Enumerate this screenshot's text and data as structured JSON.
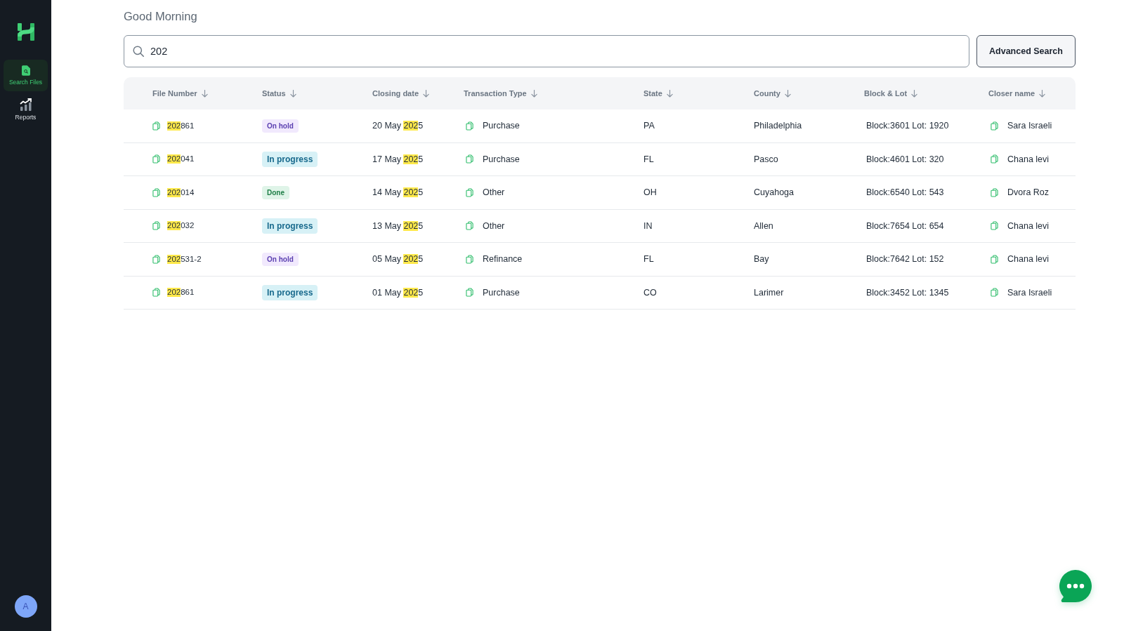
{
  "sidebar": {
    "nav": [
      {
        "label": "Search Files",
        "selected": true
      },
      {
        "label": "Reports",
        "selected": false
      }
    ],
    "avatar": {
      "initial": "A"
    }
  },
  "greeting": "Good Morning",
  "search": {
    "value": "202"
  },
  "advanced_search_button": "Advanced Search",
  "table": {
    "columns": [
      "File Number",
      "Status",
      "Closing date",
      "Transaction Type",
      "State",
      "County",
      "Block & Lot",
      "Closer name"
    ],
    "rows": [
      {
        "file_number": [
          {
            "text": "202",
            "highlighted": true
          },
          {
            "text": "861",
            "highlighted": false
          }
        ],
        "status": {
          "text": "On hold",
          "kind": "hold"
        },
        "closing_date": [
          {
            "text": "20 May ",
            "highlighted": false
          },
          {
            "text": "202",
            "highlighted": true
          },
          {
            "text": "5",
            "highlighted": false
          }
        ],
        "transaction_type": "Purchase",
        "state": "PA",
        "county": "Philadelphia",
        "block_lot": "Block:3601 Lot: 1920",
        "closer_name": "Sara Israeli"
      },
      {
        "file_number": [
          {
            "text": "202",
            "highlighted": true
          },
          {
            "text": "041",
            "highlighted": false
          }
        ],
        "status": {
          "text": "In progress",
          "kind": "progress"
        },
        "closing_date": [
          {
            "text": "17 May ",
            "highlighted": false
          },
          {
            "text": "202",
            "highlighted": true
          },
          {
            "text": "5",
            "highlighted": false
          }
        ],
        "transaction_type": "Purchase",
        "state": "FL",
        "county": "Pasco",
        "block_lot": "Block:4601 Lot: 320",
        "closer_name": "Chana levi"
      },
      {
        "file_number": [
          {
            "text": "202",
            "highlighted": true
          },
          {
            "text": "014",
            "highlighted": false
          }
        ],
        "status": {
          "text": "Done",
          "kind": "done"
        },
        "closing_date": [
          {
            "text": "14 May ",
            "highlighted": false
          },
          {
            "text": "202",
            "highlighted": true
          },
          {
            "text": "5",
            "highlighted": false
          }
        ],
        "transaction_type": "Other",
        "state": "OH",
        "county": "Cuyahoga",
        "block_lot": "Block:6540 Lot: 543",
        "closer_name": "Dvora Roz"
      },
      {
        "file_number": [
          {
            "text": "202",
            "highlighted": true
          },
          {
            "text": "032",
            "highlighted": false
          }
        ],
        "status": {
          "text": "In progress",
          "kind": "progress"
        },
        "closing_date": [
          {
            "text": "13 May ",
            "highlighted": false
          },
          {
            "text": "202",
            "highlighted": true
          },
          {
            "text": "5",
            "highlighted": false
          }
        ],
        "transaction_type": "Other",
        "state": "IN",
        "county": "Allen",
        "block_lot": "Block:7654 Lot: 654",
        "closer_name": "Chana levi"
      },
      {
        "file_number": [
          {
            "text": "202",
            "highlighted": true
          },
          {
            "text": "531-2",
            "highlighted": false
          }
        ],
        "status": {
          "text": "On hold",
          "kind": "hold"
        },
        "closing_date": [
          {
            "text": "05 May ",
            "highlighted": false
          },
          {
            "text": "202",
            "highlighted": true
          },
          {
            "text": "5",
            "highlighted": false
          }
        ],
        "transaction_type": "Refinance",
        "state": "FL",
        "county": "Bay",
        "block_lot": "Block:7642 Lot: 152",
        "closer_name": "Chana levi"
      },
      {
        "file_number": [
          {
            "text": "202",
            "highlighted": true
          },
          {
            "text": "861",
            "highlighted": false
          }
        ],
        "status": {
          "text": "In progress",
          "kind": "progress"
        },
        "closing_date": [
          {
            "text": "01 May ",
            "highlighted": false
          },
          {
            "text": "202",
            "highlighted": true
          },
          {
            "text": "5",
            "highlighted": false
          }
        ],
        "transaction_type": "Purchase",
        "state": "CO",
        "county": "Larimer",
        "block_lot": "Block:3452 Lot: 1345",
        "closer_name": "Sara Israeli"
      }
    ]
  }
}
